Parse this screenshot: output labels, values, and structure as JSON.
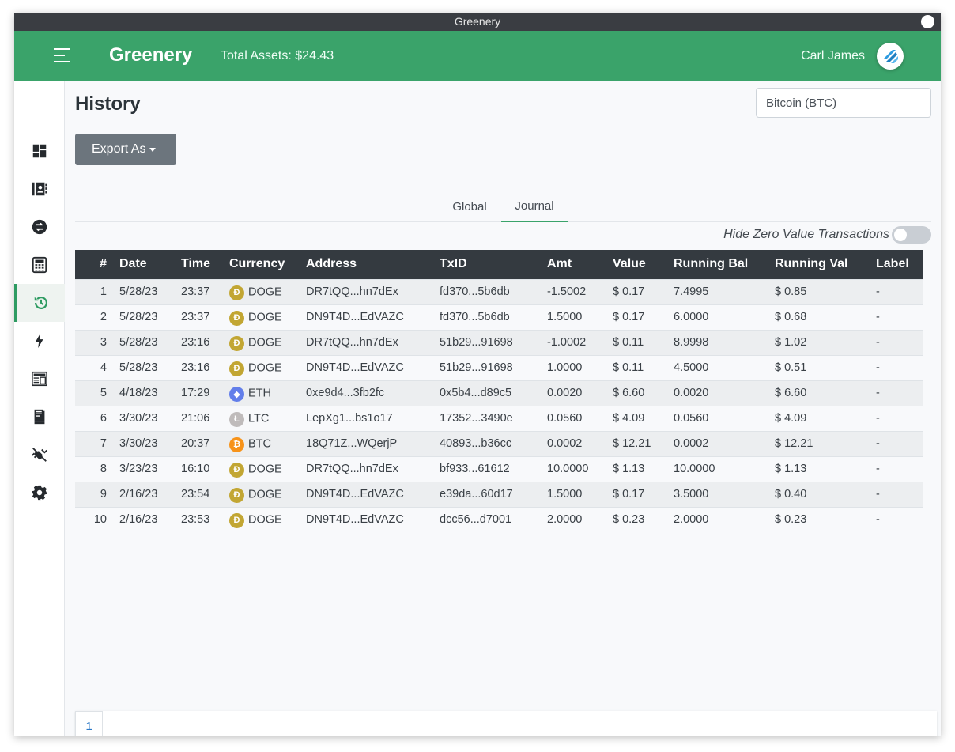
{
  "window": {
    "title": "Greenery"
  },
  "header": {
    "brand": "Greenery",
    "total_assets": "Total Assets: $24.43",
    "user_name": "Carl James"
  },
  "sidebar": {
    "items": [
      {
        "icon": "dashboard-icon"
      },
      {
        "icon": "address-book-icon"
      },
      {
        "icon": "exchange-icon"
      },
      {
        "icon": "calculator-icon"
      },
      {
        "icon": "history-icon",
        "active": true
      },
      {
        "icon": "lightning-icon"
      },
      {
        "icon": "invoice-icon"
      },
      {
        "icon": "receipt-icon"
      },
      {
        "icon": "plugin-disconnected-icon"
      },
      {
        "icon": "gear-icon"
      }
    ]
  },
  "page": {
    "title": "History",
    "currency_selected": "Bitcoin (BTC)",
    "export_label": "Export As",
    "tabs": [
      {
        "label": "Global"
      },
      {
        "label": "Journal",
        "active": true
      }
    ],
    "hide_zero_label": "Hide Zero Value Transactions",
    "hide_zero_on": false
  },
  "table": {
    "columns": [
      "#",
      "Date",
      "Time",
      "Currency",
      "Address",
      "TxID",
      "Amt",
      "Value",
      "Running Bal",
      "Running Val",
      "Label"
    ],
    "rows": [
      {
        "n": "1",
        "date": "5/28/23",
        "time": "23:37",
        "currency": "DOGE",
        "address": "DR7tQQ...hn7dEx",
        "txid": "fd370...5b6db",
        "amt": "-1.5002",
        "value": "$ 0.17",
        "running_bal": "7.4995",
        "running_val": "$ 0.85",
        "label": "-"
      },
      {
        "n": "2",
        "date": "5/28/23",
        "time": "23:37",
        "currency": "DOGE",
        "address": "DN9T4D...EdVAZC",
        "txid": "fd370...5b6db",
        "amt": "1.5000",
        "value": "$ 0.17",
        "running_bal": "6.0000",
        "running_val": "$ 0.68",
        "label": "-"
      },
      {
        "n": "3",
        "date": "5/28/23",
        "time": "23:16",
        "currency": "DOGE",
        "address": "DR7tQQ...hn7dEx",
        "txid": "51b29...91698",
        "amt": "-1.0002",
        "value": "$ 0.11",
        "running_bal": "8.9998",
        "running_val": "$ 1.02",
        "label": "-"
      },
      {
        "n": "4",
        "date": "5/28/23",
        "time": "23:16",
        "currency": "DOGE",
        "address": "DN9T4D...EdVAZC",
        "txid": "51b29...91698",
        "amt": "1.0000",
        "value": "$ 0.11",
        "running_bal": "4.5000",
        "running_val": "$ 0.51",
        "label": "-"
      },
      {
        "n": "5",
        "date": "4/18/23",
        "time": "17:29",
        "currency": "ETH",
        "address": "0xe9d4...3fb2fc",
        "txid": "0x5b4...d89c5",
        "amt": "0.0020",
        "value": "$ 6.60",
        "running_bal": "0.0020",
        "running_val": "$ 6.60",
        "label": "-"
      },
      {
        "n": "6",
        "date": "3/30/23",
        "time": "21:06",
        "currency": "LTC",
        "address": "LepXg1...bs1o17",
        "txid": "17352...3490e",
        "amt": "0.0560",
        "value": "$ 4.09",
        "running_bal": "0.0560",
        "running_val": "$ 4.09",
        "label": "-"
      },
      {
        "n": "7",
        "date": "3/30/23",
        "time": "20:37",
        "currency": "BTC",
        "address": "18Q71Z...WQerjP",
        "txid": "40893...b36cc",
        "amt": "0.0002",
        "value": "$ 12.21",
        "running_bal": "0.0002",
        "running_val": "$ 12.21",
        "label": "-"
      },
      {
        "n": "8",
        "date": "3/23/23",
        "time": "16:10",
        "currency": "DOGE",
        "address": "DR7tQQ...hn7dEx",
        "txid": "bf933...61612",
        "amt": "10.0000",
        "value": "$ 1.13",
        "running_bal": "10.0000",
        "running_val": "$ 1.13",
        "label": "-"
      },
      {
        "n": "9",
        "date": "2/16/23",
        "time": "23:54",
        "currency": "DOGE",
        "address": "DN9T4D...EdVAZC",
        "txid": "e39da...60d17",
        "amt": "1.5000",
        "value": "$ 0.17",
        "running_bal": "3.5000",
        "running_val": "$ 0.40",
        "label": "-"
      },
      {
        "n": "10",
        "date": "2/16/23",
        "time": "23:53",
        "currency": "DOGE",
        "address": "DN9T4D...EdVAZC",
        "txid": "dcc56...d7001",
        "amt": "2.0000",
        "value": "$ 0.23",
        "running_bal": "2.0000",
        "running_val": "$ 0.23",
        "label": "-"
      }
    ]
  },
  "coins": {
    "DOGE": {
      "color": "#c2a633",
      "glyph": "Ð"
    },
    "ETH": {
      "color": "#627eea",
      "glyph": "◆"
    },
    "LTC": {
      "color": "#bfbbbb",
      "glyph": "Ł"
    },
    "BTC": {
      "color": "#f7931a",
      "glyph": "₿"
    }
  },
  "pagination": {
    "current": "1"
  },
  "colors": {
    "brand": "#3aa36a",
    "header_dark": "#343a40",
    "link": "#2a78c7"
  }
}
